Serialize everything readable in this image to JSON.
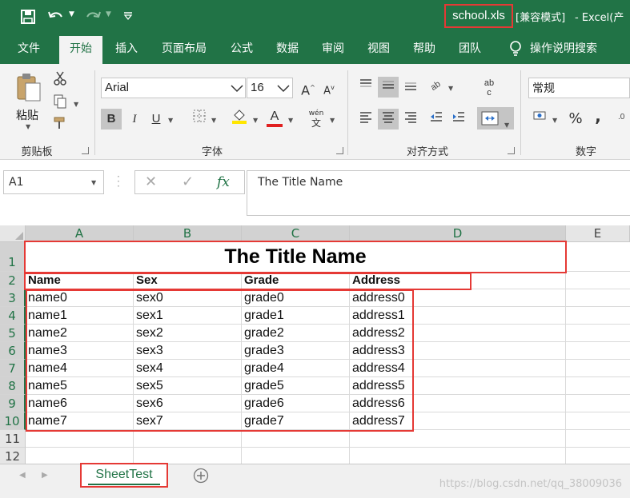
{
  "titlebar": {
    "filename": "school.xls",
    "compat_mode": "[兼容模式]",
    "app_title": "-  Excel(产"
  },
  "tabs": [
    "文件",
    "开始",
    "插入",
    "页面布局",
    "公式",
    "数据",
    "审阅",
    "视图",
    "帮助",
    "团队"
  ],
  "active_tab": "开始",
  "tell_me": "操作说明搜索",
  "ribbon": {
    "paste_label": "粘贴",
    "clipboard_group": "剪贴板",
    "font_group": "字体",
    "alignment_group": "对齐方式",
    "number_group": "数字",
    "font_name": "Arial",
    "font_size": "16",
    "number_format": "常规",
    "bold": "B",
    "italic": "I",
    "underline": "U",
    "grow_font": "A",
    "shrink_font": "A",
    "font_color_glyph": "A",
    "phonetic": "wén",
    "phonetic_sub": "文",
    "wrap_text": "ab",
    "wrap_text_sub": "c",
    "percent": "%",
    "comma": ",",
    "accent_color": "#217346",
    "fill_color": "#ffe600",
    "font_color": "#e02020"
  },
  "formula_bar": {
    "name_box": "A1",
    "fx_label": "fx",
    "formula": "The Title Name"
  },
  "sheet": {
    "columns": [
      "A",
      "B",
      "C",
      "D",
      "E"
    ],
    "rows": [
      "1",
      "2",
      "3",
      "4",
      "5",
      "6",
      "7",
      "8",
      "9",
      "10",
      "11",
      "12"
    ],
    "title": "The Title Name",
    "headers": [
      "Name",
      "Sex",
      "Grade",
      "Address"
    ],
    "data": [
      [
        "name0",
        "sex0",
        "grade0",
        "address0"
      ],
      [
        "name1",
        "sex1",
        "grade1",
        "address1"
      ],
      [
        "name2",
        "sex2",
        "grade2",
        "address2"
      ],
      [
        "name3",
        "sex3",
        "grade3",
        "address3"
      ],
      [
        "name4",
        "sex4",
        "grade4",
        "address4"
      ],
      [
        "name5",
        "sex5",
        "grade5",
        "address5"
      ],
      [
        "name6",
        "sex6",
        "grade6",
        "address6"
      ],
      [
        "name7",
        "sex7",
        "grade7",
        "address7"
      ]
    ]
  },
  "sheet_tab": "SheetTest",
  "watermark": "https://blog.csdn.net/qq_38009036",
  "highlight_color": "#e53935"
}
